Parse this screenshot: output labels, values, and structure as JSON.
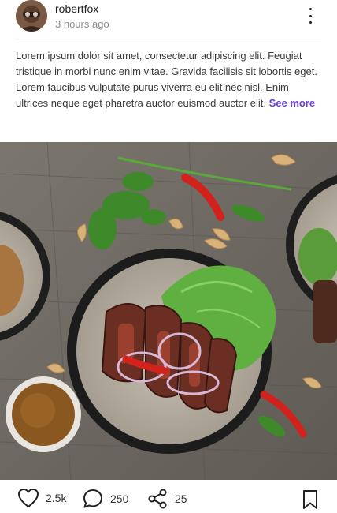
{
  "post": {
    "username": "robertfox",
    "time": "3 hours ago",
    "caption": "Lorem ipsum dolor sit amet, consectetur adipiscing elit. Feugiat tristique in morbi nunc enim vitae. Gravida facilisis sit lobortis eget. Lorem faucibus vulputate purus viverra eu elit nec nisl. Enim ultrices neque eget pharetra auctor euismod auctor elit.",
    "see_more": "See more"
  },
  "actions": {
    "likes": "2.5k",
    "comments": "250",
    "shares": "25"
  },
  "icons": {
    "like": "heart-icon",
    "comment": "comment-icon",
    "share": "share-icon",
    "bookmark": "bookmark-icon",
    "menu": "more-vertical-icon"
  },
  "colors": {
    "accent": "#6a3de8"
  }
}
